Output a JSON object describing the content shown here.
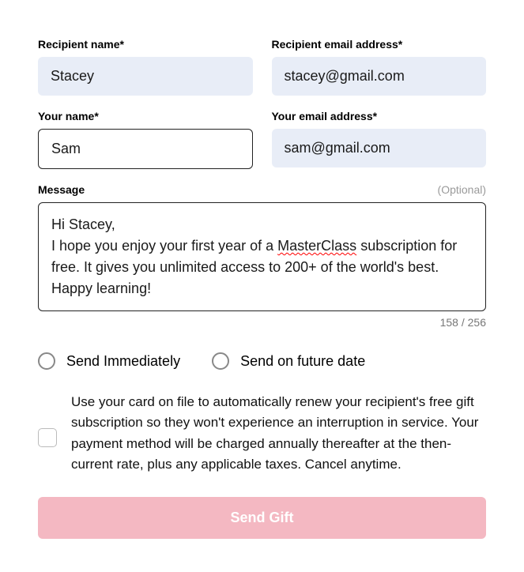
{
  "fields": {
    "recipient_name": {
      "label": "Recipient name*",
      "value": "Stacey"
    },
    "recipient_email": {
      "label": "Recipient email address*",
      "value": "stacey@gmail.com"
    },
    "your_name": {
      "label": "Your name*",
      "value": "Sam"
    },
    "your_email": {
      "label": "Your email address*",
      "value": "sam@gmail.com"
    }
  },
  "message": {
    "label": "Message",
    "optional": "(Optional)",
    "greeting": "Hi Stacey,",
    "body_part1": "I hope you enjoy your first year of a ",
    "body_spellcheck": "MasterClass",
    "body_part2": " subscription for free. It gives you unlimited access to 200+ of the world's best. Happy learning!",
    "counter": "158 / 256"
  },
  "send_timing": {
    "immediate": "Send Immediately",
    "future": "Send on future date"
  },
  "renewal_text": "Use your card on file to automatically renew your recipient's free gift subscription so they won't experience an interruption in service. Your payment method will be charged annually thereafter at the then-current rate, plus any applicable taxes. Cancel anytime.",
  "send_button": "Send Gift"
}
